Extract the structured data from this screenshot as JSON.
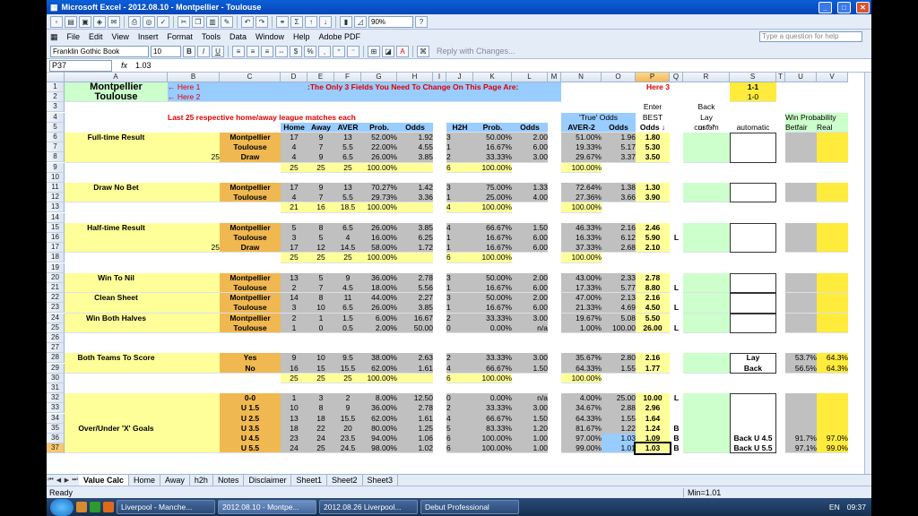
{
  "window": {
    "title": "Microsoft Excel - 2012.08.10 - Montpellier - Toulouse"
  },
  "toolbar": {
    "zoom": "90%"
  },
  "menu": [
    "File",
    "Edit",
    "View",
    "Insert",
    "Format",
    "Tools",
    "Data",
    "Window",
    "Help",
    "Adobe PDF"
  ],
  "ask_placeholder": "Type a question for help",
  "format": {
    "font": "Franklin Gothic Book",
    "size": "10",
    "reply_label": "Reply with Changes..."
  },
  "formula": {
    "cell": "P37",
    "fx": "fx",
    "value": "1.03"
  },
  "columns": [
    "A",
    "B",
    "C",
    "D",
    "E",
    "F",
    "G",
    "H",
    "I",
    "J",
    "K",
    "L",
    "M",
    "N",
    "O",
    "P",
    "Q",
    "R",
    "S",
    "T",
    "U",
    "V"
  ],
  "rows": [
    1,
    2,
    3,
    4,
    5,
    6,
    7,
    8,
    9,
    10,
    11,
    12,
    13,
    14,
    15,
    16,
    17,
    18,
    19,
    20,
    21,
    22,
    23,
    24,
    25,
    26,
    27,
    28,
    29,
    30,
    31,
    32,
    33,
    34,
    35,
    36,
    37
  ],
  "header": {
    "team1": "Montpellier",
    "team2": "Toulouse",
    "here1": "← Here 1",
    "here2": "← Here 2",
    "here3": "Here 3",
    "instruction": ":The Only 3 Fields You Need To Change On This Page Are:",
    "score1": "1-1",
    "score2": "1-0",
    "back": "Back",
    "lay": "Lay",
    "or": "or \"-\"",
    "last25": "Last 25 respective home/away league matches each",
    "true_odds": "'True' Odds",
    "enter": "Enter",
    "best": "BEST",
    "odds_arrow": "Odds ↓",
    "custom": "custom",
    "automatic": "automatic",
    "win_prob": "Win Probability",
    "betfair": "Betfair",
    "real": "Real"
  },
  "colheads": {
    "home": "Home",
    "away": "Away",
    "aver": "AVER",
    "prob": "Prob.",
    "odds": "Odds",
    "h2h": "H2H",
    "prob2": "Prob.",
    "odds2": "Odds",
    "aver2": "AVER-2",
    "odds3": "Odds"
  },
  "markets": [
    {
      "row": 6,
      "label": "Full-time Result"
    },
    {
      "row": 11,
      "label": "Draw No Bet"
    },
    {
      "row": 15,
      "label": "Half-time Result"
    },
    {
      "row": 20,
      "label": "Win To Nil"
    },
    {
      "row": 22,
      "label": "Clean Sheet"
    },
    {
      "row": 24,
      "label": "Win Both Halves"
    },
    {
      "row": 28,
      "label": "Both Teams To Score"
    },
    {
      "row": 35,
      "label": "Over/Under 'X' Goals"
    }
  ],
  "b_values": [
    {
      "row": 8,
      "v": "25"
    },
    {
      "row": 17,
      "v": "25"
    }
  ],
  "table": [
    {
      "row": 6,
      "c": "Montpellier",
      "d": "17",
      "e": "9",
      "f": "13",
      "g": "52.00%",
      "h": "1.92",
      "j": "3",
      "k": "50.00%",
      "l": "2.00",
      "n": "51.00%",
      "o": "1.96",
      "p": "1.80",
      "q": ""
    },
    {
      "row": 7,
      "c": "Toulouse",
      "d": "4",
      "e": "7",
      "f": "5.5",
      "g": "22.00%",
      "h": "4.55",
      "j": "1",
      "k": "16.67%",
      "l": "6.00",
      "n": "19.33%",
      "o": "5.17",
      "p": "5.30",
      "q": ""
    },
    {
      "row": 8,
      "c": "Draw",
      "d": "4",
      "e": "9",
      "f": "6.5",
      "g": "26.00%",
      "h": "3.85",
      "j": "2",
      "k": "33.33%",
      "l": "3.00",
      "n": "29.67%",
      "o": "3.37",
      "p": "3.50",
      "q": ""
    },
    {
      "row": 9,
      "c": "",
      "d": "25",
      "e": "25",
      "f": "25",
      "g": "100.00%",
      "h": "",
      "j": "6",
      "k": "100.00%",
      "l": "",
      "n": "100.00%",
      "o": "",
      "p": "",
      "q": ""
    },
    {
      "row": 11,
      "c": "Montpellier",
      "d": "17",
      "e": "9",
      "f": "13",
      "g": "70.27%",
      "h": "1.42",
      "j": "3",
      "k": "75.00%",
      "l": "1.33",
      "n": "72.64%",
      "o": "1.38",
      "p": "1.30",
      "q": ""
    },
    {
      "row": 12,
      "c": "Toulouse",
      "d": "4",
      "e": "7",
      "f": "5.5",
      "g": "29.73%",
      "h": "3.36",
      "j": "1",
      "k": "25.00%",
      "l": "4.00",
      "n": "27.36%",
      "o": "3.66",
      "p": "3.90",
      "q": ""
    },
    {
      "row": 13,
      "c": "",
      "d": "21",
      "e": "16",
      "f": "18.5",
      "g": "100.00%",
      "h": "",
      "j": "4",
      "k": "100.00%",
      "l": "",
      "n": "100.00%",
      "o": "",
      "p": "",
      "q": ""
    },
    {
      "row": 15,
      "c": "Montpellier",
      "d": "5",
      "e": "8",
      "f": "6.5",
      "g": "26.00%",
      "h": "3.85",
      "j": "4",
      "k": "66.67%",
      "l": "1.50",
      "n": "46.33%",
      "o": "2.16",
      "p": "2.46",
      "q": ""
    },
    {
      "row": 16,
      "c": "Toulouse",
      "d": "3",
      "e": "5",
      "f": "4",
      "g": "16.00%",
      "h": "6.25",
      "j": "1",
      "k": "16.67%",
      "l": "6.00",
      "n": "16.33%",
      "o": "6.12",
      "p": "5.90",
      "q": "L"
    },
    {
      "row": 17,
      "c": "Draw",
      "d": "17",
      "e": "12",
      "f": "14.5",
      "g": "58.00%",
      "h": "1.72",
      "j": "1",
      "k": "16.67%",
      "l": "6.00",
      "n": "37.33%",
      "o": "2.68",
      "p": "2.10",
      "q": ""
    },
    {
      "row": 18,
      "c": "",
      "d": "25",
      "e": "25",
      "f": "25",
      "g": "100.00%",
      "h": "",
      "j": "6",
      "k": "100.00%",
      "l": "",
      "n": "100.00%",
      "o": "",
      "p": "",
      "q": ""
    },
    {
      "row": 20,
      "c": "Montpellier",
      "d": "13",
      "e": "5",
      "f": "9",
      "g": "36.00%",
      "h": "2.78",
      "j": "3",
      "k": "50.00%",
      "l": "2.00",
      "n": "43.00%",
      "o": "2.33",
      "p": "2.78",
      "q": ""
    },
    {
      "row": 21,
      "c": "Toulouse",
      "d": "2",
      "e": "7",
      "f": "4.5",
      "g": "18.00%",
      "h": "5.56",
      "j": "1",
      "k": "16.67%",
      "l": "6.00",
      "n": "17.33%",
      "o": "5.77",
      "p": "8.80",
      "q": "L"
    },
    {
      "row": 22,
      "c": "Montpellier",
      "d": "14",
      "e": "8",
      "f": "11",
      "g": "44.00%",
      "h": "2.27",
      "j": "3",
      "k": "50.00%",
      "l": "2.00",
      "n": "47.00%",
      "o": "2.13",
      "p": "2.16",
      "q": ""
    },
    {
      "row": 23,
      "c": "Toulouse",
      "d": "3",
      "e": "10",
      "f": "6.5",
      "g": "26.00%",
      "h": "3.85",
      "j": "1",
      "k": "16.67%",
      "l": "6.00",
      "n": "21.33%",
      "o": "4.69",
      "p": "4.50",
      "q": "L"
    },
    {
      "row": 24,
      "c": "Montpellier",
      "d": "2",
      "e": "1",
      "f": "1.5",
      "g": "6.00%",
      "h": "16.67",
      "j": "2",
      "k": "33.33%",
      "l": "3.00",
      "n": "19.67%",
      "o": "5.08",
      "p": "5.50",
      "q": ""
    },
    {
      "row": 25,
      "c": "Toulouse",
      "d": "1",
      "e": "0",
      "f": "0.5",
      "g": "2.00%",
      "h": "50.00",
      "j": "0",
      "k": "0.00%",
      "l": "n/a",
      "n": "1.00%",
      "o": "100.00",
      "p": "26.00",
      "q": "L"
    },
    {
      "row": 28,
      "c": "Yes",
      "d": "9",
      "e": "10",
      "f": "9.5",
      "g": "38.00%",
      "h": "2.63",
      "j": "2",
      "k": "33.33%",
      "l": "3.00",
      "n": "35.67%",
      "o": "2.80",
      "p": "2.16",
      "q": ""
    },
    {
      "row": 29,
      "c": "No",
      "d": "16",
      "e": "15",
      "f": "15.5",
      "g": "62.00%",
      "h": "1.61",
      "j": "4",
      "k": "66.67%",
      "l": "1.50",
      "n": "64.33%",
      "o": "1.55",
      "p": "1.77",
      "q": ""
    },
    {
      "row": 30,
      "c": "",
      "d": "25",
      "e": "25",
      "f": "25",
      "g": "100.00%",
      "h": "",
      "j": "6",
      "k": "100.00%",
      "l": "",
      "n": "100.00%",
      "o": "",
      "p": "",
      "q": ""
    },
    {
      "row": 32,
      "c": "0-0",
      "d": "1",
      "e": "3",
      "f": "2",
      "g": "8.00%",
      "h": "12.50",
      "j": "0",
      "k": "0.00%",
      "l": "n/a",
      "n": "4.00%",
      "o": "25.00",
      "p": "10.00",
      "q": "L"
    },
    {
      "row": 33,
      "c": "U 1.5",
      "d": "10",
      "e": "8",
      "f": "9",
      "g": "36.00%",
      "h": "2.78",
      "j": "2",
      "k": "33.33%",
      "l": "3.00",
      "n": "34.67%",
      "o": "2.88",
      "p": "2.96",
      "q": ""
    },
    {
      "row": 34,
      "c": "U 2.5",
      "d": "13",
      "e": "18",
      "f": "15.5",
      "g": "62.00%",
      "h": "1.61",
      "j": "4",
      "k": "66.67%",
      "l": "1.50",
      "n": "64.33%",
      "o": "1.55",
      "p": "1.64",
      "q": ""
    },
    {
      "row": 35,
      "c": "U 3.5",
      "d": "18",
      "e": "22",
      "f": "20",
      "g": "80.00%",
      "h": "1.25",
      "j": "5",
      "k": "83.33%",
      "l": "1.20",
      "n": "81.67%",
      "o": "1.22",
      "p": "1.24",
      "q": "B"
    },
    {
      "row": 36,
      "c": "U 4.5",
      "d": "23",
      "e": "24",
      "f": "23.5",
      "g": "94.00%",
      "h": "1.06",
      "j": "6",
      "k": "100.00%",
      "l": "1.00",
      "n": "97.00%",
      "o": "1.03",
      "p": "1.09",
      "q": "B"
    },
    {
      "row": 37,
      "c": "U 5.5",
      "d": "24",
      "e": "25",
      "f": "24.5",
      "g": "98.00%",
      "h": "1.02",
      "j": "6",
      "k": "100.00%",
      "l": "1.00",
      "n": "99.00%",
      "o": "1.01",
      "p": "1.03",
      "q": "B"
    }
  ],
  "side": [
    {
      "row": 28,
      "s": "Lay",
      "u": "53.7%",
      "v": "64.3%"
    },
    {
      "row": 29,
      "s": "Back",
      "u": "56.5%",
      "v": "64.3%"
    },
    {
      "row": 36,
      "s": "Back U 4.5",
      "u": "91.7%",
      "v": "97.0%"
    },
    {
      "row": 37,
      "s": "Back U 5.5",
      "u": "97.1%",
      "v": "99.0%"
    }
  ],
  "sheets": [
    "Value Calc",
    "Home",
    "Away",
    "h2h",
    "Notes",
    "Disclaimer",
    "Sheet1",
    "Sheet2",
    "Sheet3"
  ],
  "status": {
    "ready": "Ready",
    "sum": "Min=1.01"
  },
  "taskbar": {
    "tasks": [
      "Liverpool - Manche...",
      "2012.08.10 - Montpe...",
      "2012.08.26 Liverpool...",
      "Debut Professional"
    ],
    "lang": "EN",
    "time": "09:37"
  }
}
